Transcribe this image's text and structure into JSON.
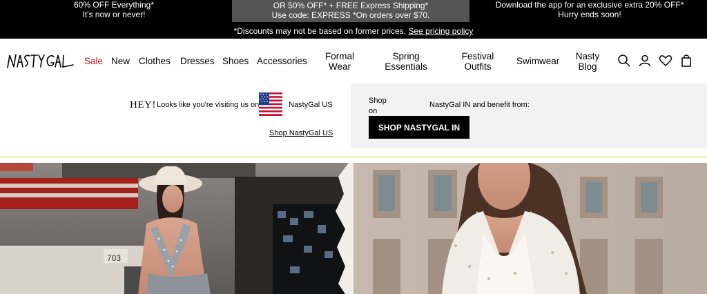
{
  "promo": {
    "left_line1": "60% OFF Everything*",
    "left_line2": "It's now or never!",
    "mid_line1": "OR 50% OFF* + FREE Express Shipping*",
    "mid_line2": "Use code: EXPRESS *On orders over $70.",
    "right_line1": "Download the app for an exclusive extra 20% OFF*",
    "right_line2": "Hurry ends soon!",
    "footnote": "*Discounts may not be based on former prices.",
    "footnote_link": "See pricing policy"
  },
  "header": {
    "logo_alt": "NASTY GAL",
    "nav": [
      {
        "line1": "Sale",
        "line2": ""
      },
      {
        "line1": "New",
        "line2": ""
      },
      {
        "line1": "Clothes",
        "line2": ""
      },
      {
        "line1": "Dresses",
        "line2": ""
      },
      {
        "line1": "Shoes",
        "line2": ""
      },
      {
        "line1": "Accessories",
        "line2": ""
      },
      {
        "line1": "Formal",
        "line2": "Wear"
      },
      {
        "line1": "Spring",
        "line2": "Essentials"
      },
      {
        "line1": "Festival",
        "line2": "Outfits"
      },
      {
        "line1": "Swimwear",
        "line2": ""
      },
      {
        "line1": "Nasty",
        "line2": "Blog"
      }
    ],
    "icons": [
      "search-icon",
      "account-icon",
      "wishlist-heart-icon",
      "shopping-bag-icon"
    ]
  },
  "country_banner": {
    "hey": "HEY!",
    "visit_text": "Looks like you're visiting us on",
    "us_site": "NastyGal US",
    "shop_us_link": "Shop NastyGal US",
    "shop_on_line1": "Shop",
    "shop_on_line2": "on",
    "in_text": "NastyGal IN and benefit from:",
    "shop_in_button": "SHOP NASTYGAL IN"
  },
  "hero": {
    "building_number": "703"
  },
  "colors": {
    "sale": "#c8102e",
    "promo_bg": "#000000",
    "promo_mid_bg": "#555555",
    "banner_accent": "#e9f0a5"
  }
}
